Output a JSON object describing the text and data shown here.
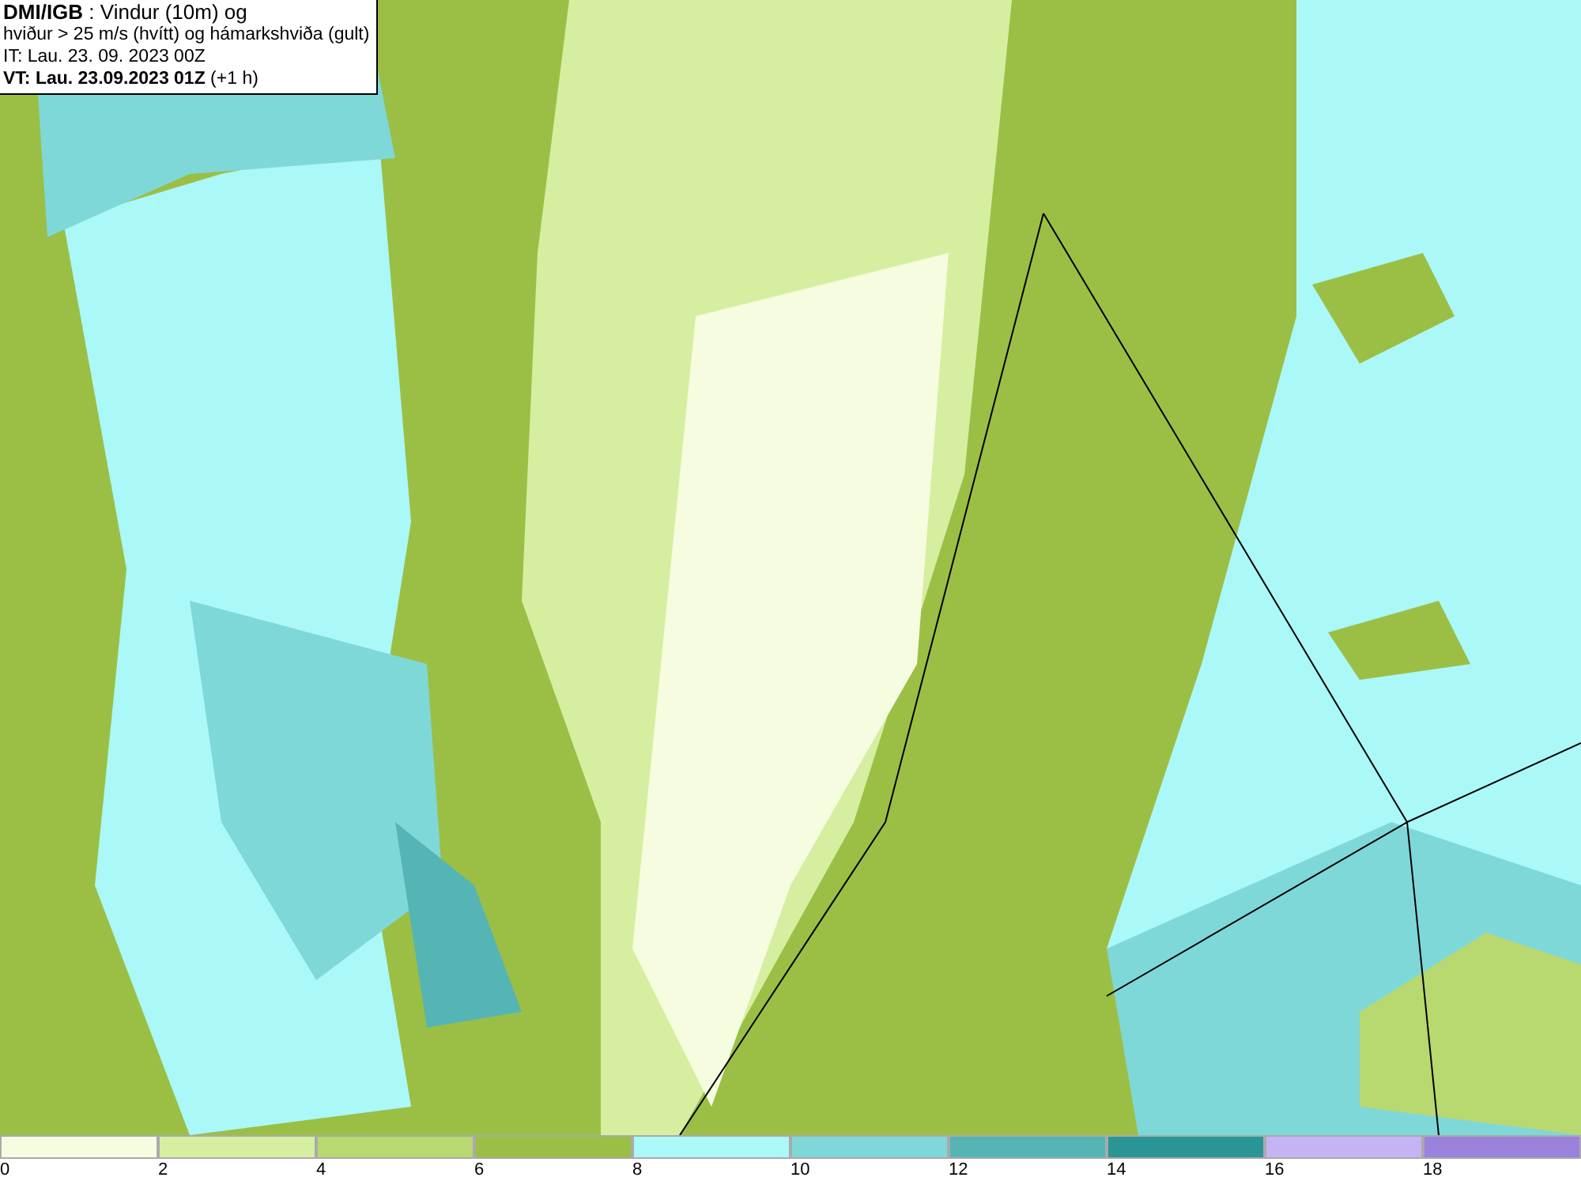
{
  "info_box": {
    "lines": [
      "**DMI/IGB** : Vindur (10m) og",
      "hviður > 25 m/s (hvítt) og hámarkshviða (gult)",
      "IT: Lau. 23. 09. 2023 00Z",
      "**VT: Lau. 23.09.2023 01Z** (+1 h)"
    ]
  },
  "legend": {
    "bins": [
      {
        "label": "0",
        "color": "#f5fce0"
      },
      {
        "label": "2",
        "color": "#d6eea0"
      },
      {
        "label": "4",
        "color": "#b8d870"
      },
      {
        "label": "6",
        "color": "#9bbf45"
      },
      {
        "label": "8",
        "color": "#aaf8f8"
      },
      {
        "label": "10",
        "color": "#7fd8d8"
      },
      {
        "label": "12",
        "color": "#55b5b5"
      },
      {
        "label": "14",
        "color": "#2a9595"
      },
      {
        "label": "16",
        "color": "#c4b4f4"
      },
      {
        "label": "18",
        "color": "#9b82dc"
      }
    ]
  }
}
